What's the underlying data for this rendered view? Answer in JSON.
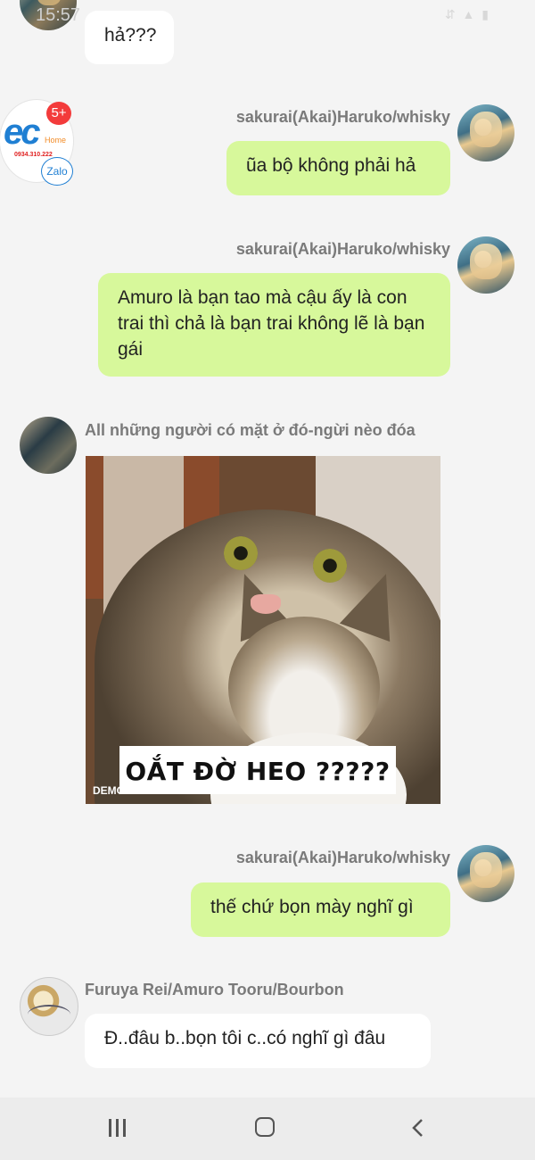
{
  "status_bar": {
    "time": "15:57",
    "tiktok_glyph": "♪",
    "right_icons": "⇵ ▲ ▮"
  },
  "contact_badge": {
    "logo_text": "ec",
    "logo_sub": "Home",
    "phone": "0934.310.222",
    "unread_count": "5+",
    "zalo_label": "Zalo"
  },
  "messages": [
    {
      "type": "incoming",
      "text": "hả???"
    },
    {
      "type": "outgoing",
      "sender": "sakurai(Akai)Haruko/whisky",
      "text": "ũa bộ không phải hả"
    },
    {
      "type": "outgoing",
      "sender": "sakurai(Akai)Haruko/whisky",
      "text": "Amuro là bạn tao mà cậu ấy là con trai thì chả là bạn trai không lẽ là bạn gái"
    },
    {
      "type": "incoming-image",
      "sender": "All những người có mặt ở đó-ngừi nèo đóa",
      "caption": "OẮT ĐỜ HEO ?????",
      "watermark": "DEMODAY"
    },
    {
      "type": "outgoing",
      "sender": "sakurai(Akai)Haruko/whisky",
      "text": "thế chứ bọn mày nghĩ gì"
    },
    {
      "type": "incoming",
      "sender": "Furuya Rei/Amuro Tooru/Bourbon",
      "text": "Đ..đâu b..bọn tôi c..có nghĩ gì đâu"
    }
  ],
  "nav": {
    "recent_icon": "recent-apps-icon",
    "home_icon": "home-icon",
    "back_icon": "back-icon"
  },
  "colors": {
    "background": "#f4f4f4",
    "outgoing_bubble": "#d7f89b",
    "incoming_bubble": "#ffffff",
    "sender_name": "#7a7a7a"
  }
}
